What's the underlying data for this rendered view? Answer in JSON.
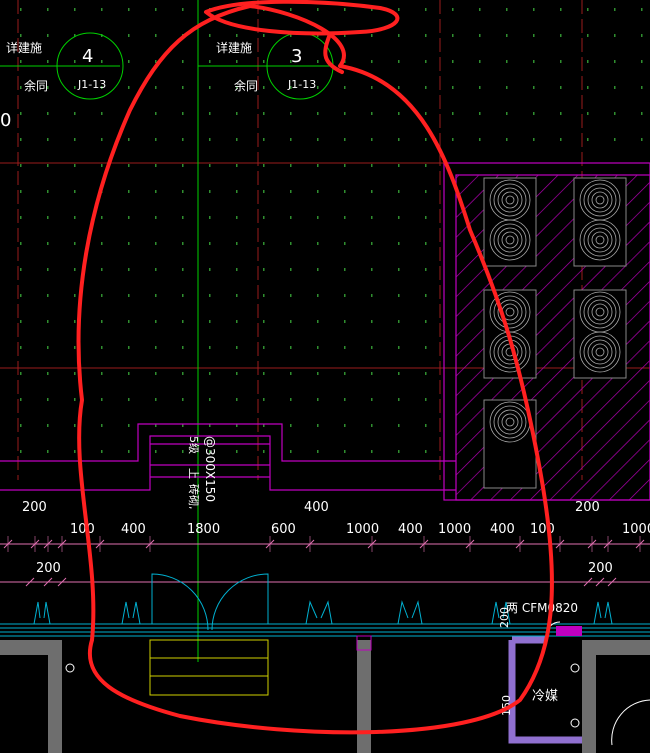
{
  "callouts": [
    {
      "note": "详建施",
      "sub": "余同",
      "number": "4",
      "ref": "J1-13"
    },
    {
      "note": "详建施",
      "sub": "余同",
      "number": "3",
      "ref": "J1-13"
    }
  ],
  "stair": {
    "direction_label": "5级",
    "up_label": "上",
    "mid_label": "砖砌,",
    "step_spec": "@300X150"
  },
  "dimensions": {
    "upper_row": [
      "200",
      "400",
      "200"
    ],
    "main_row": [
      "100",
      "400",
      "1800",
      "600",
      "1000",
      "400",
      "1000",
      "400",
      "100",
      "1000"
    ],
    "lower_row": [
      "200",
      "200"
    ]
  },
  "labels": {
    "window_code": "两 CFM0820",
    "vertical_dim_1": "200",
    "vertical_dim_2": "150",
    "room_label": "冷媒",
    "left_edge_mark": "0"
  },
  "colors": {
    "background": "#000000",
    "grid_dot": "#2f8f2f",
    "axis_red": "#9a1c1c",
    "wall_magenta": "#c000c0",
    "dimension_pink": "#e070b0",
    "cyan_wall": "#00b0d0",
    "green_axis": "#00d000",
    "white_text": "#ffffff",
    "yellow": "#d0d000",
    "gray_fill": "#6e6e6e",
    "annotation_red": "#ff2020"
  }
}
